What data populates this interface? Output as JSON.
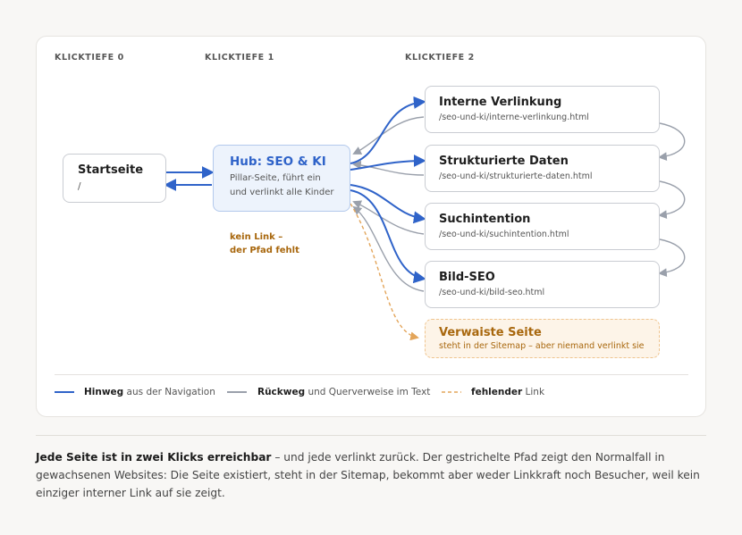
{
  "columns": {
    "depth0": "KLICKTIEFE 0",
    "depth1": "KLICKTIEFE 1",
    "depth2": "KLICKTIEFE 2"
  },
  "start": {
    "title": "Startseite",
    "path": "/"
  },
  "hub": {
    "title": "Hub: SEO & KI",
    "desc_line1": "Pillar-Seite, führt ein",
    "desc_line2": "und verlinkt alle Kinder"
  },
  "children": [
    {
      "title": "Interne Verlinkung",
      "path": "/seo-und-ki/interne-verlinkung.html"
    },
    {
      "title": "Strukturierte Daten",
      "path": "/seo-und-ki/strukturierte-daten.html"
    },
    {
      "title": "Suchintention",
      "path": "/seo-und-ki/suchintention.html"
    },
    {
      "title": "Bild-SEO",
      "path": "/seo-und-ki/bild-seo.html"
    }
  ],
  "orphan": {
    "title": "Verwaiste Seite",
    "note": "steht in der Sitemap – aber niemand verlinkt sie"
  },
  "no_link_note": {
    "line1": "kein Link –",
    "line2": "der Pfad fehlt"
  },
  "legend": {
    "forward_bold": "Hinweg",
    "forward_rest": " aus der Navigation",
    "back_bold": "Rückweg",
    "back_rest": " und Querverweise im Text",
    "missing_bold": "fehlender",
    "missing_rest": " Link"
  },
  "caption": {
    "bold": "Jede Seite ist in zwei Klicks erreichbar",
    "rest": " – und jede verlinkt zurück. Der gestrichelte Pfad zeigt den Normalfall in gewachsenen Websites: Die Seite existiert, steht in der Sitemap, bekommt aber weder Linkkraft noch Besucher, weil kein einziger interner Link auf sie zeigt."
  },
  "colors": {
    "forward": "#2f63c9",
    "back": "#9aa0ab",
    "missing": "#e3a55a",
    "hub_title": "#2f63c9",
    "orphan_text": "#a8670d"
  }
}
